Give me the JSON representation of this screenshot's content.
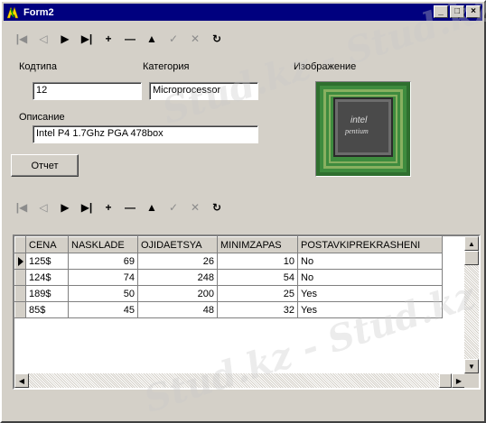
{
  "window": {
    "title": "Form2"
  },
  "titlebar_buttons": {
    "minimize": "_",
    "maximize": "□",
    "close": "×"
  },
  "navigator": {
    "buttons": [
      {
        "name": "first",
        "glyph": "|◀",
        "enabled": false
      },
      {
        "name": "prior",
        "glyph": "◁",
        "enabled": false
      },
      {
        "name": "next",
        "glyph": "▶",
        "enabled": true
      },
      {
        "name": "last",
        "glyph": "▶|",
        "enabled": true
      },
      {
        "name": "insert",
        "glyph": "+",
        "enabled": true
      },
      {
        "name": "delete",
        "glyph": "—",
        "enabled": true
      },
      {
        "name": "edit",
        "glyph": "▲",
        "enabled": true
      },
      {
        "name": "post",
        "glyph": "✓",
        "enabled": false
      },
      {
        "name": "cancel",
        "glyph": "✕",
        "enabled": false
      },
      {
        "name": "refresh",
        "glyph": "↻",
        "enabled": true
      }
    ]
  },
  "form": {
    "kodtipa_label": "Кодтипа",
    "kodtipa_value": "12",
    "category_label": "Категория",
    "category_value": "Microprocessor",
    "image_label": "Изображение",
    "description_label": "Описание",
    "description_value": "Intel P4 1.7Ghz PGA 478box",
    "report_button": "Отчет",
    "chip_brand": "intel",
    "chip_model": "pentium"
  },
  "grid": {
    "columns": [
      "CENA",
      "NASKLADE",
      "OJIDAETSYA",
      "MINIMZAPAS",
      "POSTAVKIPREKRASHENI"
    ],
    "rows": [
      {
        "current": true,
        "cells": [
          "125$",
          "69",
          "26",
          "10",
          "No"
        ]
      },
      {
        "current": false,
        "cells": [
          "124$",
          "74",
          "248",
          "54",
          "No"
        ]
      },
      {
        "current": false,
        "cells": [
          "189$",
          "50",
          "200",
          "25",
          "Yes"
        ]
      },
      {
        "current": false,
        "cells": [
          "85$",
          "45",
          "48",
          "32",
          "Yes"
        ]
      }
    ]
  },
  "watermark": "Stud.kz - Stud.kz"
}
